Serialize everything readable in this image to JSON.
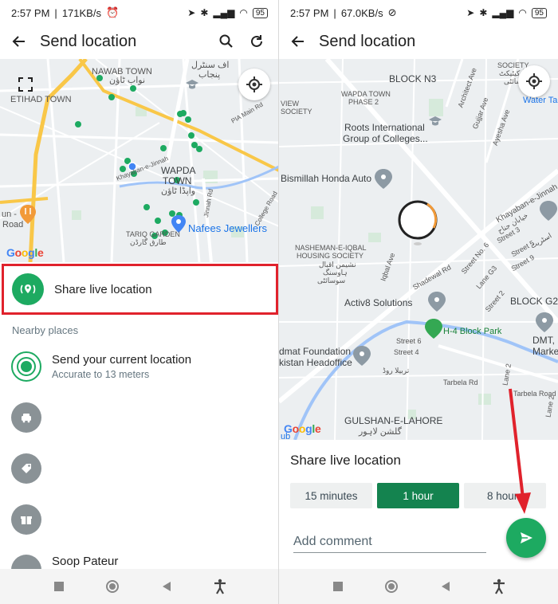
{
  "colors": {
    "accent": "#1daa61",
    "accent_dark": "#14834f",
    "highlight_box": "#e0222c",
    "annotation_arrow": "#e0222c"
  },
  "left": {
    "status": {
      "time": "2:57 PM",
      "speed": "171KB/s",
      "battery": "95"
    },
    "app_bar": {
      "title": "Send location",
      "icons": [
        "back-arrow-icon",
        "search-icon",
        "refresh-icon"
      ]
    },
    "map": {
      "labels": {
        "nawab_town": "NAWAB TOWN",
        "nawab_town_ur": "نواب ٹاؤن",
        "etihad_town": "ETIHAD TOWN",
        "punjab_ur": "اف سنٹرل",
        "punjab_ur2": "پنجاب",
        "wapda_town": "WAPDA",
        "wapda_town2": "TOWN",
        "wapda_town_ur": "واپڈا ٹاؤن",
        "tariq_garden": "TARIQ GARDEN",
        "tariq_garden_ur": "طارق گارڈن",
        "nafees": "Nafees Jewellers",
        "khayaban": "Khayaban-e-Jinnah",
        "pia_main": "PIA Main Rd",
        "jinnah_rd": "Jinnah Rd",
        "college_rd": "College Road",
        "road": "Road",
        "un": "un -"
      }
    },
    "share_live_label": "Share live location",
    "nearby_header": "Nearby places",
    "current_location": {
      "title": "Send your current location",
      "subtitle": "Accurate to 13 meters"
    },
    "partial_place": "Soop Pateur"
  },
  "right": {
    "status": {
      "time": "2:57 PM",
      "speed": "67.0KB/s",
      "battery": "95"
    },
    "app_bar": {
      "title": "Send location",
      "icons": [
        "back-arrow-icon"
      ]
    },
    "map": {
      "labels": {
        "block_n3": "BLOCK N3",
        "wapda_phase2": "WAPDA TOWN",
        "wapda_phase2b": "PHASE 2",
        "view_society": "VIEW",
        "society": "SOCIETY",
        "roots": "Roots International",
        "roots2": "Group of Colleges...",
        "bismillah": "Bismillah Honda Auto",
        "architect": "Architect Ave",
        "gujjar": "Gujjar Ave",
        "ayesha": "Ayesha Ave",
        "society_top": "SOCIETY",
        "society_ur": "آرکیٹیکٹ",
        "society_ur2": "سوسائٹی",
        "water_tank": "Water Ta",
        "khayaban": "Khayaban-e-Jinnah",
        "khayaban_ur": "خیابان جناح",
        "nasheman": "NASHEMAN-E-IQBAL",
        "nasheman2": "HOUSING SOCIETY",
        "nasheman_ur": "نشیمن اقبال",
        "nasheman_ur2": "ہاوسنگ",
        "nasheman_ur3": "سوسائٹی",
        "iqbal_ave": "Iqbal Ave",
        "activ8": "Activ8 Solutions",
        "shadewal": "Shadewal Rd",
        "street6": "Street No. 6",
        "lane_g3": "Lane G3",
        "street3": "Street 3",
        "street5": "Street 5",
        "street_ur": "اسٹریٹ",
        "street9": "Street 9",
        "street2": "Street 2",
        "block_g2": "BLOCK G2",
        "h4_park": "H-4 Block Park",
        "street4": "Street 4",
        "street6b": "Street 6",
        "dmt": "DMT,",
        "marke": "Marke",
        "idmat": "dmat Foundation",
        "idmat2": "kistan Headoffice",
        "tarbela_ur": "تربیلا روڈ",
        "tarbela": "Tarbela Rd",
        "tarbela_road": "Tarbela Road",
        "lane2": "Lane 2",
        "lane2b": "Lane 2",
        "gulshan": "GULSHAN-E-LAHORE",
        "gulshan_ur": "گلشن لاہور",
        "hub": "ub"
      }
    },
    "sheet": {
      "title": "Share live location",
      "durations": [
        {
          "label": "15 minutes",
          "selected": false
        },
        {
          "label": "1 hour",
          "selected": true
        },
        {
          "label": "8 hours",
          "selected": false
        }
      ],
      "comment_placeholder": "Add comment"
    }
  },
  "google_logo": "Google"
}
